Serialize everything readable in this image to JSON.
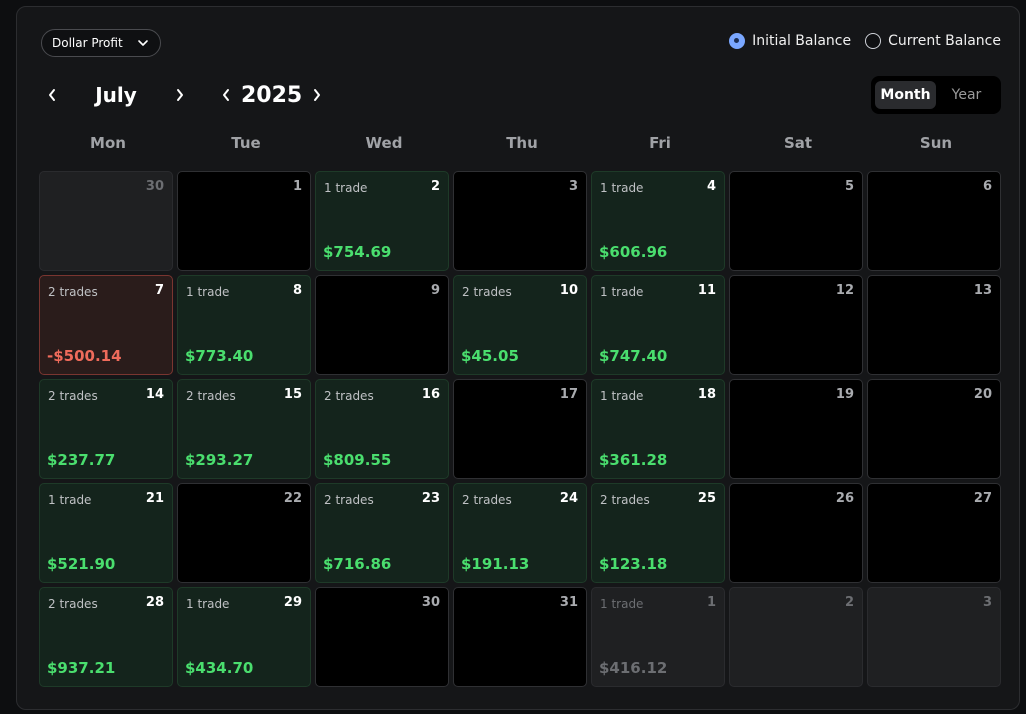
{
  "filter": {
    "label": "Dollar Profit"
  },
  "balance_options": [
    {
      "label": "Initial Balance",
      "selected": true
    },
    {
      "label": "Current Balance",
      "selected": false
    }
  ],
  "nav": {
    "month": "July",
    "year": "2025"
  },
  "view_toggle": {
    "month": "Month",
    "year": "Year",
    "active": "Month"
  },
  "weekdays": [
    "Mon",
    "Tue",
    "Wed",
    "Thu",
    "Fri",
    "Sat",
    "Sun"
  ],
  "colors": {
    "profit": "#4ade6e",
    "loss": "#ef6b5b",
    "accent": "#7aa7ff"
  },
  "days": [
    {
      "day": "30",
      "trades": "",
      "pnl": "",
      "type": "other"
    },
    {
      "day": "1",
      "trades": "",
      "pnl": "",
      "type": "empty"
    },
    {
      "day": "2",
      "trades": "1 trade",
      "pnl": "$754.69",
      "type": "profit"
    },
    {
      "day": "3",
      "trades": "",
      "pnl": "",
      "type": "empty"
    },
    {
      "day": "4",
      "trades": "1 trade",
      "pnl": "$606.96",
      "type": "profit"
    },
    {
      "day": "5",
      "trades": "",
      "pnl": "",
      "type": "empty"
    },
    {
      "day": "6",
      "trades": "",
      "pnl": "",
      "type": "empty"
    },
    {
      "day": "7",
      "trades": "2 trades",
      "pnl": "-$500.14",
      "type": "loss"
    },
    {
      "day": "8",
      "trades": "1 trade",
      "pnl": "$773.40",
      "type": "profit"
    },
    {
      "day": "9",
      "trades": "",
      "pnl": "",
      "type": "empty"
    },
    {
      "day": "10",
      "trades": "2 trades",
      "pnl": "$45.05",
      "type": "profit"
    },
    {
      "day": "11",
      "trades": "1 trade",
      "pnl": "$747.40",
      "type": "profit"
    },
    {
      "day": "12",
      "trades": "",
      "pnl": "",
      "type": "empty"
    },
    {
      "day": "13",
      "trades": "",
      "pnl": "",
      "type": "empty"
    },
    {
      "day": "14",
      "trades": "2 trades",
      "pnl": "$237.77",
      "type": "profit"
    },
    {
      "day": "15",
      "trades": "2 trades",
      "pnl": "$293.27",
      "type": "profit"
    },
    {
      "day": "16",
      "trades": "2 trades",
      "pnl": "$809.55",
      "type": "profit"
    },
    {
      "day": "17",
      "trades": "",
      "pnl": "",
      "type": "empty"
    },
    {
      "day": "18",
      "trades": "1 trade",
      "pnl": "$361.28",
      "type": "profit"
    },
    {
      "day": "19",
      "trades": "",
      "pnl": "",
      "type": "empty"
    },
    {
      "day": "20",
      "trades": "",
      "pnl": "",
      "type": "empty"
    },
    {
      "day": "21",
      "trades": "1 trade",
      "pnl": "$521.90",
      "type": "profit"
    },
    {
      "day": "22",
      "trades": "",
      "pnl": "",
      "type": "empty"
    },
    {
      "day": "23",
      "trades": "2 trades",
      "pnl": "$716.86",
      "type": "profit"
    },
    {
      "day": "24",
      "trades": "2 trades",
      "pnl": "$191.13",
      "type": "profit"
    },
    {
      "day": "25",
      "trades": "2 trades",
      "pnl": "$123.18",
      "type": "profit"
    },
    {
      "day": "26",
      "trades": "",
      "pnl": "",
      "type": "empty"
    },
    {
      "day": "27",
      "trades": "",
      "pnl": "",
      "type": "empty"
    },
    {
      "day": "28",
      "trades": "2 trades",
      "pnl": "$937.21",
      "type": "profit"
    },
    {
      "day": "29",
      "trades": "1 trade",
      "pnl": "$434.70",
      "type": "profit"
    },
    {
      "day": "30",
      "trades": "",
      "pnl": "",
      "type": "empty"
    },
    {
      "day": "31",
      "trades": "",
      "pnl": "",
      "type": "empty"
    },
    {
      "day": "1",
      "trades": "1 trade",
      "pnl": "$416.12",
      "type": "other"
    },
    {
      "day": "2",
      "trades": "",
      "pnl": "",
      "type": "other"
    },
    {
      "day": "3",
      "trades": "",
      "pnl": "",
      "type": "other"
    }
  ]
}
